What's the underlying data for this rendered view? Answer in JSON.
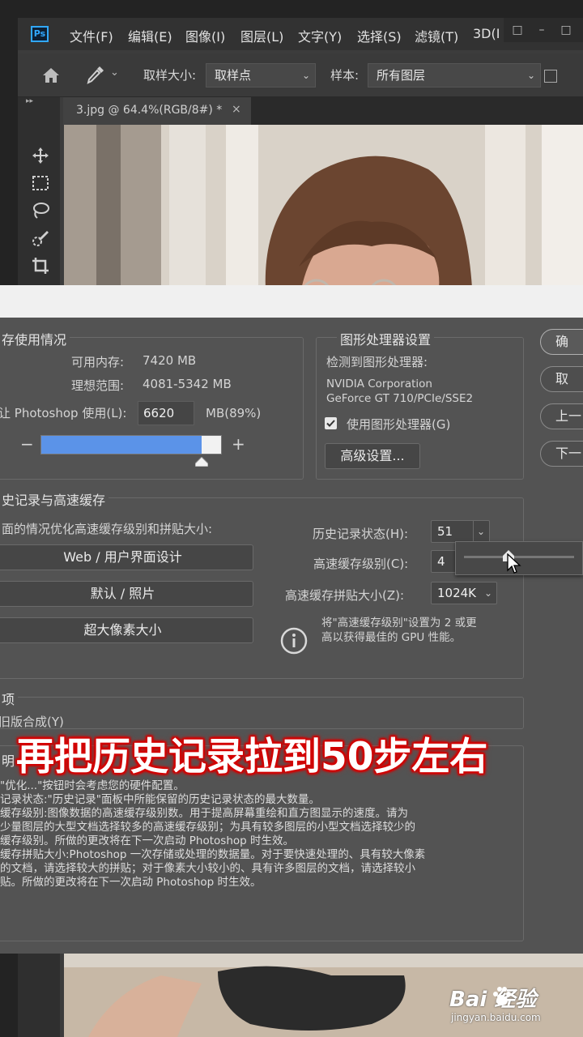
{
  "app": {
    "logo": "Ps",
    "menu": [
      "文件(F)",
      "编辑(E)",
      "图像(I)",
      "图层(L)",
      "文字(Y)",
      "选择(S)",
      "滤镜(T)",
      "3D(I"
    ],
    "window_controls": [
      "□",
      "–",
      "□"
    ]
  },
  "options_bar": {
    "home_icon": "home-icon",
    "eyedropper_icon": "eyedropper-icon",
    "sample_size_label": "取样大小:",
    "sample_size_value": "取样点",
    "sample_label": "样本:",
    "sample_value": "所有图层"
  },
  "toolbar": {
    "collapse": "▸▸",
    "tools": [
      "move-icon",
      "marquee-icon",
      "lasso-icon",
      "quick-select-icon",
      "crop-icon",
      "frame-icon"
    ]
  },
  "document": {
    "tab_title": "3.jpg @ 64.4%(RGB/8#) *",
    "close": "×"
  },
  "dialog": {
    "memory": {
      "title": "存使用情况",
      "available_label": "可用内存:",
      "available_value": "7420 MB",
      "ideal_label": "理想范围:",
      "ideal_value": "4081-5342 MB",
      "let_label": "让 Photoshop 使用(L):",
      "let_value": "6620",
      "let_unit": "MB(89%)",
      "minus": "−",
      "plus": "+",
      "usage_fraction": 0.89
    },
    "gpu": {
      "title": "图形处理器设置",
      "detected_label": "检测到图形处理器:",
      "vendor": "NVIDIA Corporation",
      "model": "GeForce GT 710/PCIe/SSE2",
      "use_gpu_label": "使用图形处理器(G)",
      "use_gpu_checked": true,
      "advanced_button": "高级设置..."
    },
    "side_buttons": [
      "确",
      "取",
      "上一",
      "下一"
    ],
    "history": {
      "title": "史记录与高速缓存",
      "optimize_label": "面的情况优化高速缓存级别和拼贴大小:",
      "preset_buttons": [
        "Web / 用户界面设计",
        "默认 / 照片",
        "超大像素大小"
      ],
      "history_states_label": "历史记录状态(H):",
      "history_states_value": "51",
      "cache_levels_label": "高速缓存级别(C):",
      "cache_levels_value": "4",
      "cache_tile_label": "高速缓存拼贴大小(Z):",
      "cache_tile_value": "1024K",
      "info_icon": "info-icon",
      "gpu_tip_line1": "将\"高速缓存级别\"设置为 2 或更",
      "gpu_tip_line2": "高以获得最佳的 GPU 性能。"
    },
    "options": {
      "title": "项",
      "legacy_composite": "旧版合成(Y)"
    },
    "description": {
      "title": "明",
      "lines": [
        "\"优化...\"按钮时会考虑您的硬件配置。",
        "记录状态:\"历史记录\"面板中所能保留的历史记录状态的最大数量。",
        "缓存级别:图像数据的高速缓存级别数。用于提高屏幕重绘和直方图显示的速度。请为",
        "少量图层的大型文档选择较多的高速缓存级别；为具有较多图层的小型文档选择较少的",
        "缓存级别。所做的更改将在下一次启动 Photoshop 时生效。",
        "缓存拼贴大小:Photoshop 一次存储或处理的数据量。对于要快速处理的、具有较大像素",
        "的文档，请选择较大的拼贴；对于像素大小较小的、具有许多图层的文档，请选择较小",
        "贴。所做的更改将在下一次启动 Photoshop 时生效。"
      ]
    }
  },
  "caption": "再把历史记录拉到50步左右",
  "watermark": {
    "logo": "Bai  经验",
    "url": "jingyan.baidu.com"
  },
  "colors": {
    "memory_bar": "#5b93e8",
    "caption_glow": "#d40000",
    "ps_blue": "#31a8ff"
  }
}
